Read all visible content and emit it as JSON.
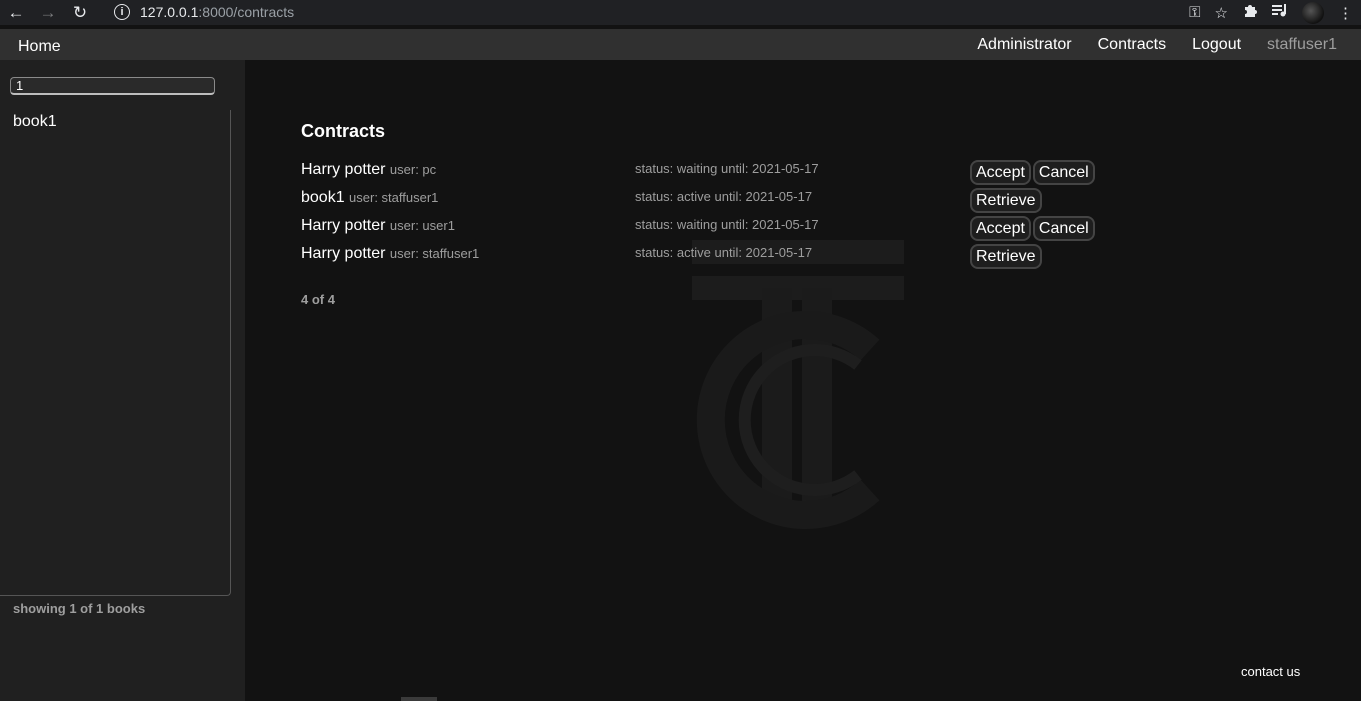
{
  "browser": {
    "url_host": "127.0.0.1",
    "url_path": ":8000/contracts"
  },
  "nav": {
    "home": "Home",
    "links": [
      "Administrator",
      "Contracts",
      "Logout"
    ],
    "username": "staffuser1"
  },
  "sidebar": {
    "search_value": "1",
    "books": [
      "book1"
    ],
    "showing": "showing 1 of 1 books"
  },
  "main": {
    "title": "Contracts",
    "contracts": [
      {
        "book": "Harry potter",
        "user": "user: pc",
        "status": "status: waiting until: 2021-05-17",
        "actions": [
          "Accept",
          "Cancel"
        ]
      },
      {
        "book": "book1",
        "user": "user: staffuser1",
        "status": "status: active until: 2021-05-17",
        "actions": [
          "Retrieve"
        ]
      },
      {
        "book": "Harry potter",
        "user": "user: user1",
        "status": "status: waiting until: 2021-05-17",
        "actions": [
          "Accept",
          "Cancel"
        ]
      },
      {
        "book": "Harry potter",
        "user": "user: staffuser1",
        "status": "status: active until: 2021-05-17",
        "actions": [
          "Retrieve"
        ]
      }
    ],
    "count": "4 of 4",
    "contact": "contact us"
  },
  "icons": {
    "back": "back-arrow-icon",
    "forward": "forward-arrow-icon",
    "reload": "reload-icon",
    "info": "site-info-icon",
    "key": "key-icon",
    "star": "bookmark-star-icon",
    "extensions": "puzzle-icon",
    "media": "media-queue-icon",
    "menu": "kebab-menu-icon"
  }
}
